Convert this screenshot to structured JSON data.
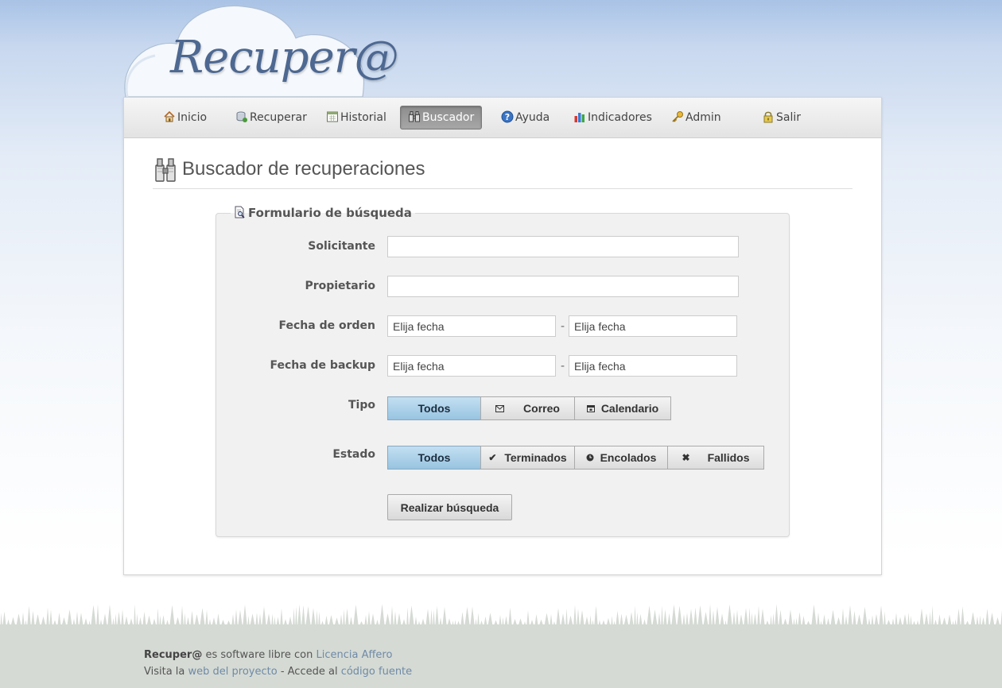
{
  "app": {
    "logo_text": "Recuper@"
  },
  "nav": {
    "items": [
      {
        "label": "Inicio",
        "icon": "home-icon"
      },
      {
        "label": "Recuperar",
        "icon": "database-icon"
      },
      {
        "label": "Historial",
        "icon": "calendar-icon"
      },
      {
        "label": "Buscador",
        "icon": "binoculars-icon",
        "active": true
      },
      {
        "label": "Ayuda",
        "icon": "help-icon"
      },
      {
        "label": "Indicadores",
        "icon": "bar-chart-icon"
      },
      {
        "label": "Admin",
        "icon": "key-icon"
      },
      {
        "label": "Salir",
        "icon": "lock-icon"
      }
    ]
  },
  "page": {
    "title": "Buscador de recuperaciones"
  },
  "form": {
    "legend": "Formulario de búsqueda",
    "solicitante": {
      "label": "Solicitante",
      "value": ""
    },
    "propietario": {
      "label": "Propietario",
      "value": ""
    },
    "fecha_orden": {
      "label": "Fecha de orden",
      "from_placeholder": "Elija fecha",
      "to_placeholder": "Elija fecha",
      "separator": "-"
    },
    "fecha_backup": {
      "label": "Fecha de backup",
      "from_placeholder": "Elija fecha",
      "to_placeholder": "Elija fecha",
      "separator": "-"
    },
    "tipo": {
      "label": "Tipo",
      "options": [
        "Todos",
        "Correo",
        "Calendario"
      ],
      "selected": "Todos"
    },
    "estado": {
      "label": "Estado",
      "options": [
        "Todos",
        "Terminados",
        "Encolados",
        "Fallidos"
      ],
      "selected": "Todos"
    },
    "submit_label": "Realizar búsqueda"
  },
  "footer": {
    "line1_brand": "Recuper@",
    "line1_text": " es software libre con ",
    "line1_link": "Licencia Affero",
    "line2_text1": "Visita la ",
    "line2_link1": "web del proyecto",
    "line2_text2": " - Accede al ",
    "line2_link2": "código fuente"
  },
  "colors": {
    "accent_selected": "#98c4e1",
    "link": "#6f8aa7",
    "footer_bg": "#d5dad4"
  }
}
